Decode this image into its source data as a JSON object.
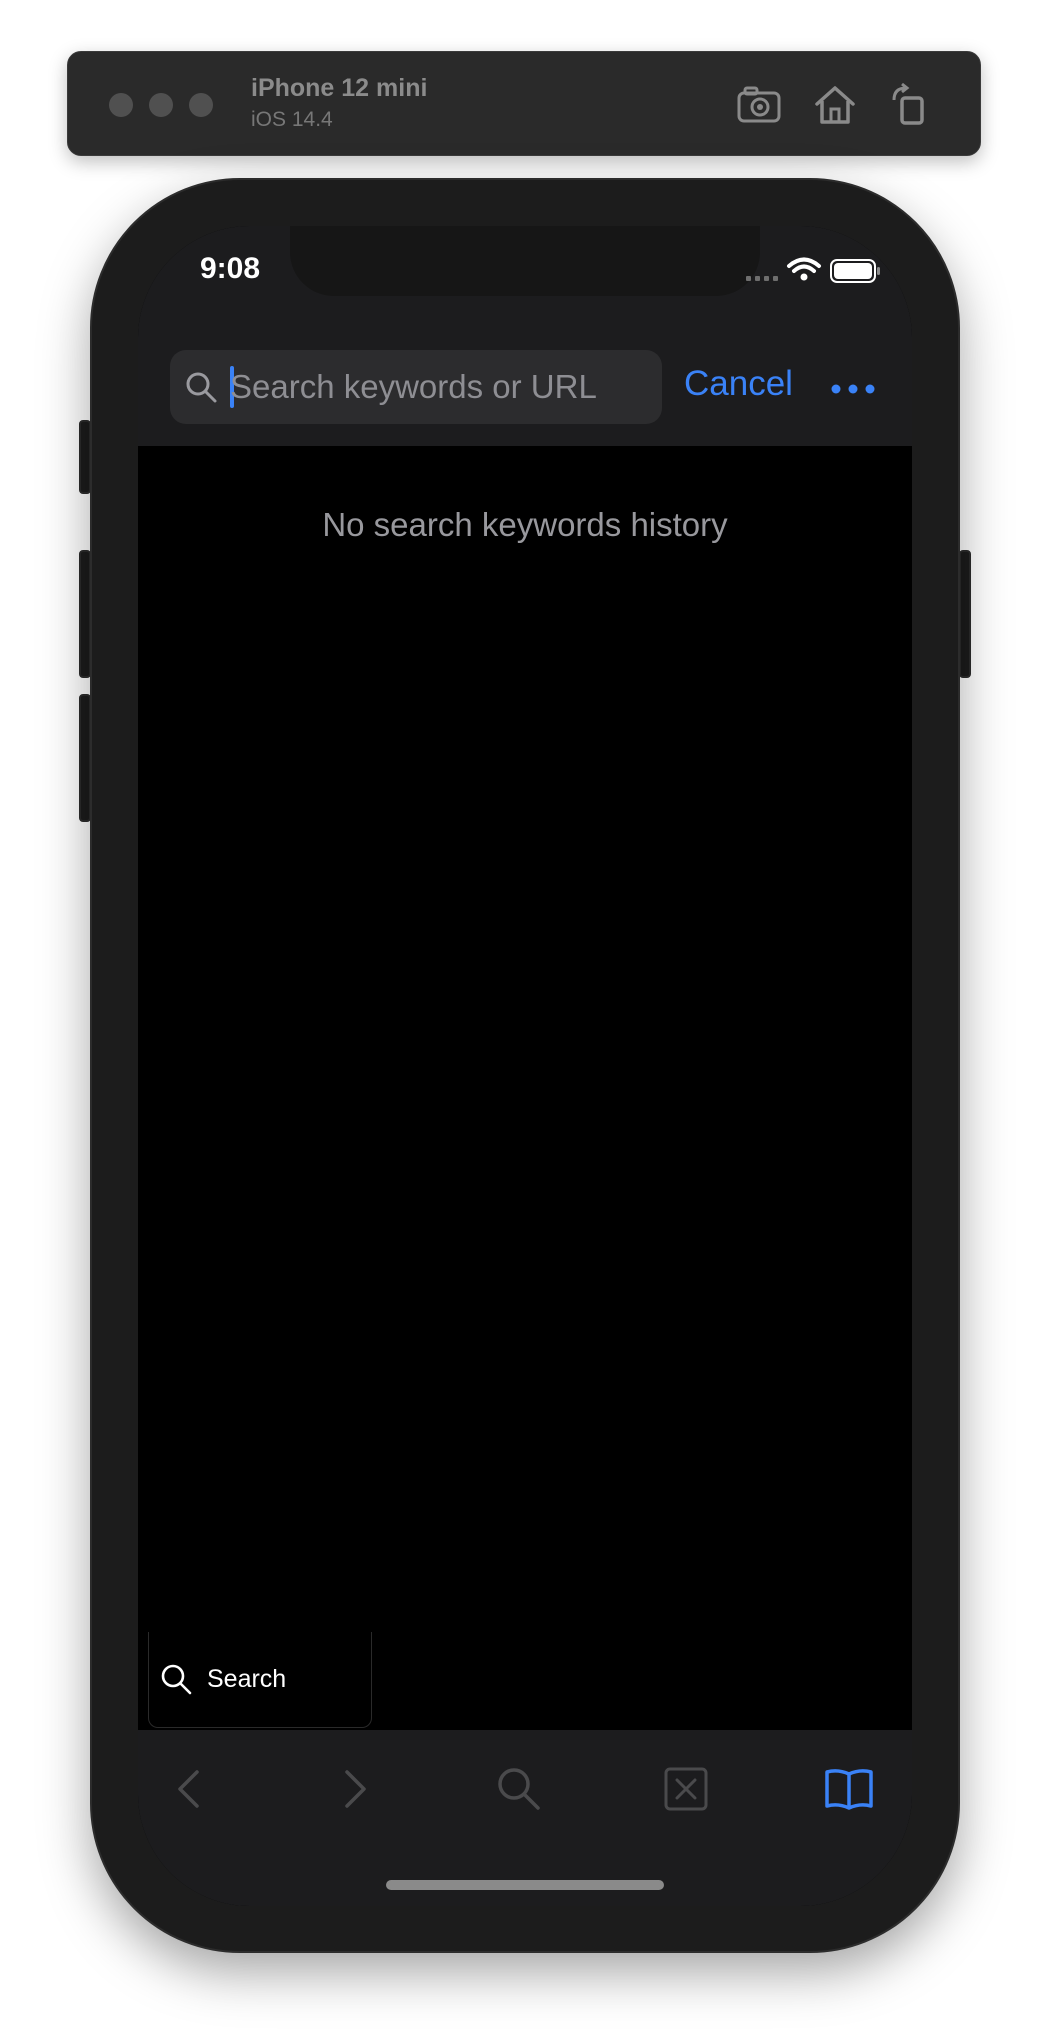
{
  "simulator": {
    "device_name": "iPhone 12 mini",
    "os_version": "iOS 14.4",
    "buttons": {
      "screenshot_icon": "camera-icon",
      "home_icon": "home-icon",
      "rotate_icon": "rotate-icon"
    }
  },
  "status_bar": {
    "time": "9:08",
    "icons": [
      "cellular-icon",
      "wifi-icon",
      "battery-icon"
    ]
  },
  "search": {
    "placeholder": "Search keywords or URL",
    "value": "",
    "cancel_label": "Cancel",
    "more_icon": "more-icon"
  },
  "main": {
    "empty_message": "No search keywords history"
  },
  "search_chip": {
    "label": "Search",
    "icon": "search-icon"
  },
  "toolbar": {
    "items": [
      "back-icon",
      "forward-icon",
      "search-icon",
      "close-tab-icon",
      "bookmarks-icon"
    ]
  },
  "colors": {
    "accent": "#3a82f7",
    "background": "#000000",
    "bar": "#1c1c1e",
    "muted_text": "#98989d"
  }
}
